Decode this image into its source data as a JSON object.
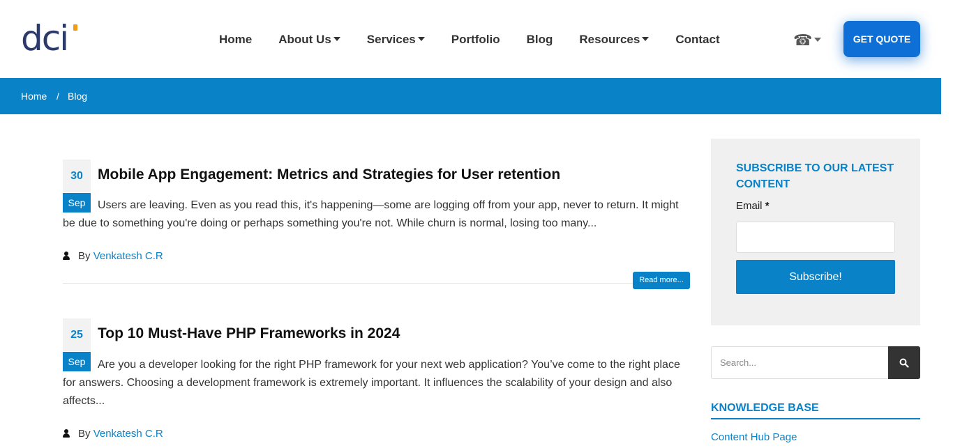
{
  "header": {
    "logo_text": "dci",
    "nav": [
      {
        "label": "Home",
        "has_dropdown": false
      },
      {
        "label": "About Us",
        "has_dropdown": true
      },
      {
        "label": "Services",
        "has_dropdown": true
      },
      {
        "label": "Portfolio",
        "has_dropdown": false
      },
      {
        "label": "Blog",
        "has_dropdown": false
      },
      {
        "label": "Resources",
        "has_dropdown": true
      },
      {
        "label": "Contact",
        "has_dropdown": false
      }
    ],
    "phone_icon": "☎",
    "cta_label": "GET QUOTE"
  },
  "breadcrumb": {
    "home": "Home",
    "separator": "/",
    "current": "Blog"
  },
  "posts": [
    {
      "day": "30",
      "month": "Sep",
      "title": "Mobile App Engagement: Metrics and Strategies for User retention",
      "excerpt": "Users are leaving. Even as you read this, it's happening—some are logging off from your app, never to return. It might be due to something you're doing or perhaps something you're not. While churn is normal, losing too many...",
      "by": "By",
      "author": "Venkatesh C.R",
      "read_more": "Read more..."
    },
    {
      "day": "25",
      "month": "Sep",
      "title": "Top 10 Must-Have PHP Frameworks in 2024",
      "excerpt": "Are you a developer looking for the right PHP framework for your next web application? You’ve come to the right place for answers. Choosing a development framework is extremely important. It influences the scalability of your design and also affects...",
      "by": "By",
      "author": "Venkatesh C.R"
    }
  ],
  "sidebar": {
    "subscribe_title": "SUBSCRIBE TO OUR LATEST CONTENT",
    "email_label": "Email",
    "required_mark": "*",
    "subscribe_button": "Subscribe!",
    "search_placeholder": "Search...",
    "kb_title": "KNOWLEDGE BASE",
    "kb_link": "Content Hub Page"
  },
  "colors": {
    "primary_blue": "#0a82c8",
    "cta_blue": "#0e6fd6",
    "logo_navy": "#2b3a6b",
    "logo_accent": "#f39c12"
  }
}
